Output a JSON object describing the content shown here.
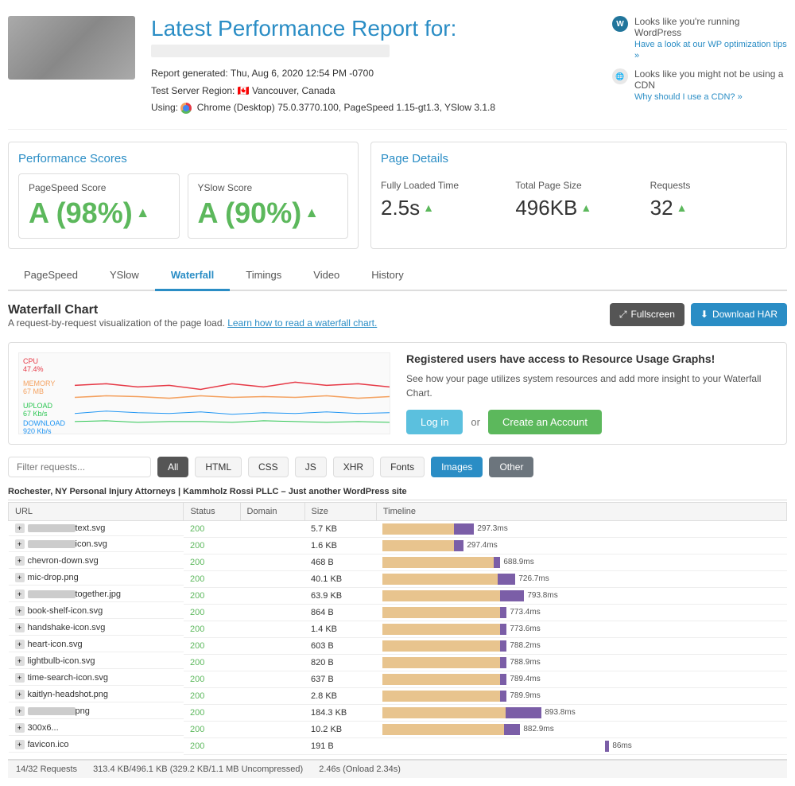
{
  "header": {
    "title": "Latest Performance Report for:",
    "subtitle_placeholder": "URL hidden",
    "report_generated_label": "Report generated:",
    "report_generated_value": "Thu, Aug 6, 2020  12:54 PM -0700",
    "test_server_label": "Test Server Region:",
    "test_server_value": "Vancouver, Canada",
    "using_label": "Using:",
    "using_value": "Chrome (Desktop) 75.0.3770.100, PageSpeed 1.15-gt1.3, YSlow 3.1.8",
    "wp_notice": "Looks like you're running WordPress",
    "wp_link": "Have a look at our WP optimization tips »",
    "cdn_notice": "Looks like you might not be using a CDN",
    "cdn_link": "Why should I use a CDN? »"
  },
  "performance_scores": {
    "title": "Performance Scores",
    "pagespeed_label": "PageSpeed Score",
    "pagespeed_value": "A (98%)",
    "yslow_label": "YSlow Score",
    "yslow_value": "A (90%)"
  },
  "page_details": {
    "title": "Page Details",
    "fully_loaded_label": "Fully Loaded Time",
    "fully_loaded_value": "2.5s",
    "total_size_label": "Total Page Size",
    "total_size_value": "496KB",
    "requests_label": "Requests",
    "requests_value": "32"
  },
  "tabs": [
    {
      "label": "PageSpeed",
      "active": false
    },
    {
      "label": "YSlow",
      "active": false
    },
    {
      "label": "Waterfall",
      "active": true
    },
    {
      "label": "Timings",
      "active": false
    },
    {
      "label": "Video",
      "active": false
    },
    {
      "label": "History",
      "active": false
    }
  ],
  "waterfall": {
    "title": "Waterfall Chart",
    "description": "A request-by-request visualization of the page load.",
    "learn_link": "Learn how to read a waterfall chart.",
    "fullscreen_btn": "Fullscreen",
    "download_btn": "Download HAR"
  },
  "resource_usage": {
    "cpu_label": "CPU",
    "cpu_value": "47.4%",
    "memory_label": "MEMORY",
    "memory_value": "67 MB",
    "upload_label": "UPLOAD",
    "upload_value": "67 Kb/s",
    "download_label": "DOWNLOAD",
    "download_value": "920 Kb/s",
    "title": "Registered users have access to Resource Usage Graphs!",
    "desc": "See how your page utilizes system resources and add more insight to your Waterfall Chart.",
    "login_btn": "Log in",
    "or_text": "or",
    "create_btn": "Create an Account"
  },
  "filter": {
    "placeholder": "Filter requests...",
    "buttons": [
      "All",
      "HTML",
      "CSS",
      "JS",
      "XHR",
      "Fonts",
      "Images",
      "Other"
    ]
  },
  "table": {
    "site_label": "Rochester, NY Personal Injury Attorneys | Kammholz Rossi PLLC – Just another WordPress site",
    "columns": [
      "URL",
      "Status",
      "Domain",
      "Size",
      "Timeline"
    ],
    "rows": [
      {
        "url": "...text.svg",
        "blurred_url": true,
        "status": "200",
        "domain": "",
        "size": "5.7 KB",
        "bar_wait": 90,
        "bar_recv": 25,
        "timeline_label": "297.3ms"
      },
      {
        "url": "...icon.svg",
        "blurred_url": true,
        "status": "200",
        "domain": "",
        "size": "1.6 KB",
        "bar_wait": 90,
        "bar_recv": 12,
        "timeline_label": "297.4ms"
      },
      {
        "url": "chevron-down.svg",
        "blurred_url": false,
        "status": "200",
        "domain": "",
        "size": "468 B",
        "bar_wait": 140,
        "bar_recv": 8,
        "timeline_label": "688.9ms"
      },
      {
        "url": "mic-drop.png",
        "blurred_url": false,
        "status": "200",
        "domain": "",
        "size": "40.1 KB",
        "bar_wait": 145,
        "bar_recv": 22,
        "timeline_label": "726.7ms"
      },
      {
        "url": "...together.jpg",
        "blurred_url": true,
        "status": "200",
        "domain": "",
        "size": "63.9 KB",
        "bar_wait": 148,
        "bar_recv": 30,
        "timeline_label": "793.8ms"
      },
      {
        "url": "book-shelf-icon.svg",
        "blurred_url": false,
        "status": "200",
        "domain": "",
        "size": "864 B",
        "bar_wait": 148,
        "bar_recv": 8,
        "timeline_label": "773.4ms"
      },
      {
        "url": "handshake-icon.svg",
        "blurred_url": false,
        "status": "200",
        "domain": "",
        "size": "1.4 KB",
        "bar_wait": 148,
        "bar_recv": 8,
        "timeline_label": "773.6ms"
      },
      {
        "url": "heart-icon.svg",
        "blurred_url": false,
        "status": "200",
        "domain": "",
        "size": "603 B",
        "bar_wait": 148,
        "bar_recv": 8,
        "timeline_label": "788.2ms"
      },
      {
        "url": "lightbulb-icon.svg",
        "blurred_url": false,
        "status": "200",
        "domain": "",
        "size": "820 B",
        "bar_wait": 148,
        "bar_recv": 8,
        "timeline_label": "788.9ms"
      },
      {
        "url": "time-search-icon.svg",
        "blurred_url": false,
        "status": "200",
        "domain": "",
        "size": "637 B",
        "bar_wait": 148,
        "bar_recv": 8,
        "timeline_label": "789.4ms"
      },
      {
        "url": "kaitlyn-headshot.png",
        "blurred_url": false,
        "status": "200",
        "domain": "",
        "size": "2.8 KB",
        "bar_wait": 148,
        "bar_recv": 8,
        "timeline_label": "789.9ms"
      },
      {
        "url": "...png",
        "blurred_url": true,
        "status": "200",
        "domain": "",
        "size": "184.3 KB",
        "bar_wait": 155,
        "bar_recv": 45,
        "timeline_label": "893.8ms"
      },
      {
        "url": "300x6...",
        "blurred_url": false,
        "status": "200",
        "domain": "",
        "size": "10.2 KB",
        "bar_wait": 153,
        "bar_recv": 20,
        "timeline_label": "882.9ms"
      },
      {
        "url": "favicon.ico",
        "blurred_url": false,
        "status": "200",
        "domain": "",
        "size": "191 B",
        "bar_wait": 0,
        "bar_recv": 5,
        "timeline_label": "86ms",
        "far_right": true
      }
    ]
  },
  "footer": {
    "requests": "14/32 Requests",
    "size": "313.4 KB/496.1 KB (329.2 KB/1.1 MB Uncompressed)",
    "time": "2.46s (Onload 2.34s)"
  }
}
